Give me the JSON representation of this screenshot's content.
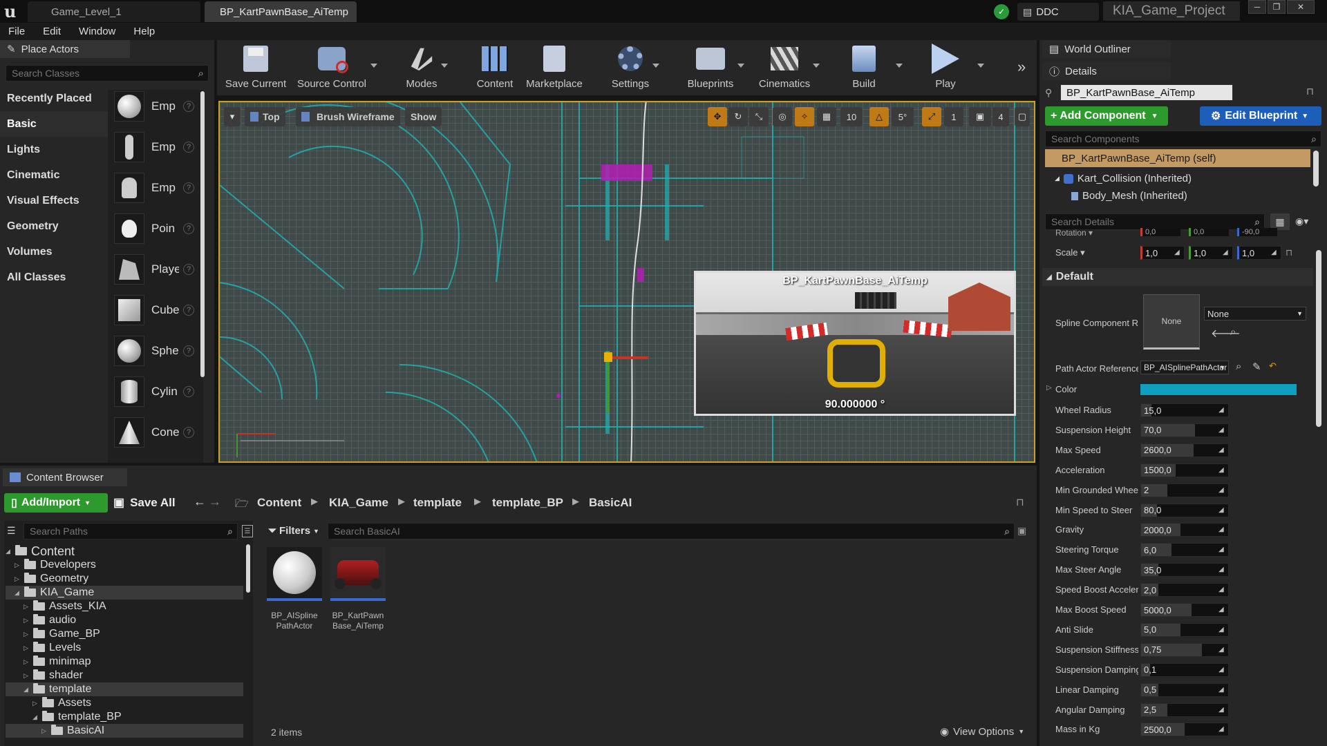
{
  "titlebar": {
    "tabs": [
      "Game_Level_1",
      "BP_KartPawnBase_AiTemp"
    ],
    "ddc_label": "DDC",
    "project_name": "KIA_Game_Project"
  },
  "menu": [
    "File",
    "Edit",
    "Window",
    "Help"
  ],
  "place_actors": {
    "title": "Place Actors",
    "search_placeholder": "Search Classes",
    "categories": [
      "Recently Placed",
      "Basic",
      "Lights",
      "Cinematic",
      "Visual Effects",
      "Geometry",
      "Volumes",
      "All Classes"
    ],
    "selected_category": "Basic",
    "items": [
      "Emp",
      "Emp",
      "Emp",
      "Poin",
      "Playe",
      "Cube",
      "Sphe",
      "Cylin",
      "Cone"
    ]
  },
  "toolbar": {
    "buttons": [
      "Save Current",
      "Source Control",
      "Modes",
      "Content",
      "Marketplace",
      "Settings",
      "Blueprints",
      "Cinematics",
      "Build",
      "Play"
    ]
  },
  "viewport": {
    "view_label": "Top",
    "render_mode": "Brush Wireframe",
    "show_label": "Show",
    "grid_snap": "10",
    "rot_snap": "5°",
    "scale_snap": "1",
    "camera_speed": "4",
    "preview": {
      "title": "BP_KartPawnBase_AiTemp",
      "angle": "90.000000 °"
    }
  },
  "outliner": {
    "world_outliner": "World Outliner",
    "details": "Details",
    "actor_name": "BP_KartPawnBase_AiTemp",
    "add_component": "+ Add Component",
    "edit_blueprint": "Edit Blueprint",
    "search_components": "Search Components",
    "components": [
      "BP_KartPawnBase_AiTemp (self)",
      "Kart_Collision (Inherited)",
      "Body_Mesh (Inherited)"
    ],
    "search_details": "Search Details",
    "rotation_label": "Rotation",
    "rotation": [
      "0,0",
      "0,0",
      "-90,0"
    ],
    "scale_label": "Scale",
    "scale": [
      "1,0",
      "1,0",
      "1,0"
    ],
    "default_section": "Default",
    "spline_label": "Spline Component Re",
    "spline_thumb": "None",
    "spline_value": "None",
    "path_actor_label": "Path Actor Reference",
    "path_actor_value": "BP_AISplinePathActor",
    "color_label": "Color",
    "color_value": "#0fa0c0",
    "properties": [
      {
        "label": "Wheel Radius",
        "value": "15,0",
        "fill": 0.12
      },
      {
        "label": "Suspension Height",
        "value": "70,0",
        "fill": 0.62
      },
      {
        "label": "Max Speed",
        "value": "2600,0",
        "fill": 0.6
      },
      {
        "label": "Acceleration",
        "value": "1500,0",
        "fill": 0.4
      },
      {
        "label": "Min Grounded Wheels",
        "value": "2",
        "fill": 0.3
      },
      {
        "label": "Min Speed to Steer",
        "value": "80,0",
        "fill": 0.18
      },
      {
        "label": "Gravity",
        "value": "2000,0",
        "fill": 0.45
      },
      {
        "label": "Steering Torque",
        "value": "6,0",
        "fill": 0.35
      },
      {
        "label": "Max Steer Angle",
        "value": "35,0",
        "fill": 0.2
      },
      {
        "label": "Speed Boost Acceleration",
        "value": "2,0",
        "fill": 0.2
      },
      {
        "label": "Max Boost Speed",
        "value": "5000,0",
        "fill": 0.58
      },
      {
        "label": "Anti Slide",
        "value": "5,0",
        "fill": 0.45
      },
      {
        "label": "Suspension Stiffness",
        "value": "0,75",
        "fill": 0.7
      },
      {
        "label": "Suspension Damping",
        "value": "0,1",
        "fill": 0.1
      },
      {
        "label": "Linear Damping",
        "value": "0,5",
        "fill": 0.2
      },
      {
        "label": "Angular Damping",
        "value": "2,5",
        "fill": 0.3
      },
      {
        "label": "Mass in Kg",
        "value": "2500,0",
        "fill": 0.5
      }
    ]
  },
  "content_browser": {
    "title": "Content Browser",
    "add_import": "Add/Import",
    "save_all": "Save All",
    "breadcrumb": [
      "Content",
      "KIA_Game",
      "template",
      "template_BP",
      "BasicAI"
    ],
    "search_paths": "Search Paths",
    "filters": "Filters",
    "search_assets": "Search BasicAI",
    "tree": [
      {
        "label": "Content",
        "depth": 0,
        "open": true
      },
      {
        "label": "Developers",
        "depth": 1,
        "open": false
      },
      {
        "label": "Geometry",
        "depth": 1,
        "open": false
      },
      {
        "label": "KIA_Game",
        "depth": 1,
        "open": true
      },
      {
        "label": "Assets_KIA",
        "depth": 2,
        "open": false
      },
      {
        "label": "audio",
        "depth": 2,
        "open": false
      },
      {
        "label": "Game_BP",
        "depth": 2,
        "open": false
      },
      {
        "label": "Levels",
        "depth": 2,
        "open": false
      },
      {
        "label": "minimap",
        "depth": 2,
        "open": false
      },
      {
        "label": "shader",
        "depth": 2,
        "open": false
      },
      {
        "label": "template",
        "depth": 2,
        "open": true
      },
      {
        "label": "Assets",
        "depth": 3,
        "open": false
      },
      {
        "label": "template_BP",
        "depth": 3,
        "open": true
      },
      {
        "label": "BasicAI",
        "depth": 4,
        "open": false
      }
    ],
    "assets": [
      {
        "name": "BP_AISpline\nPathActor"
      },
      {
        "name": "BP_KartPawn\nBase_AiTemp"
      }
    ],
    "item_count": "2 items",
    "view_options": "View Options"
  }
}
